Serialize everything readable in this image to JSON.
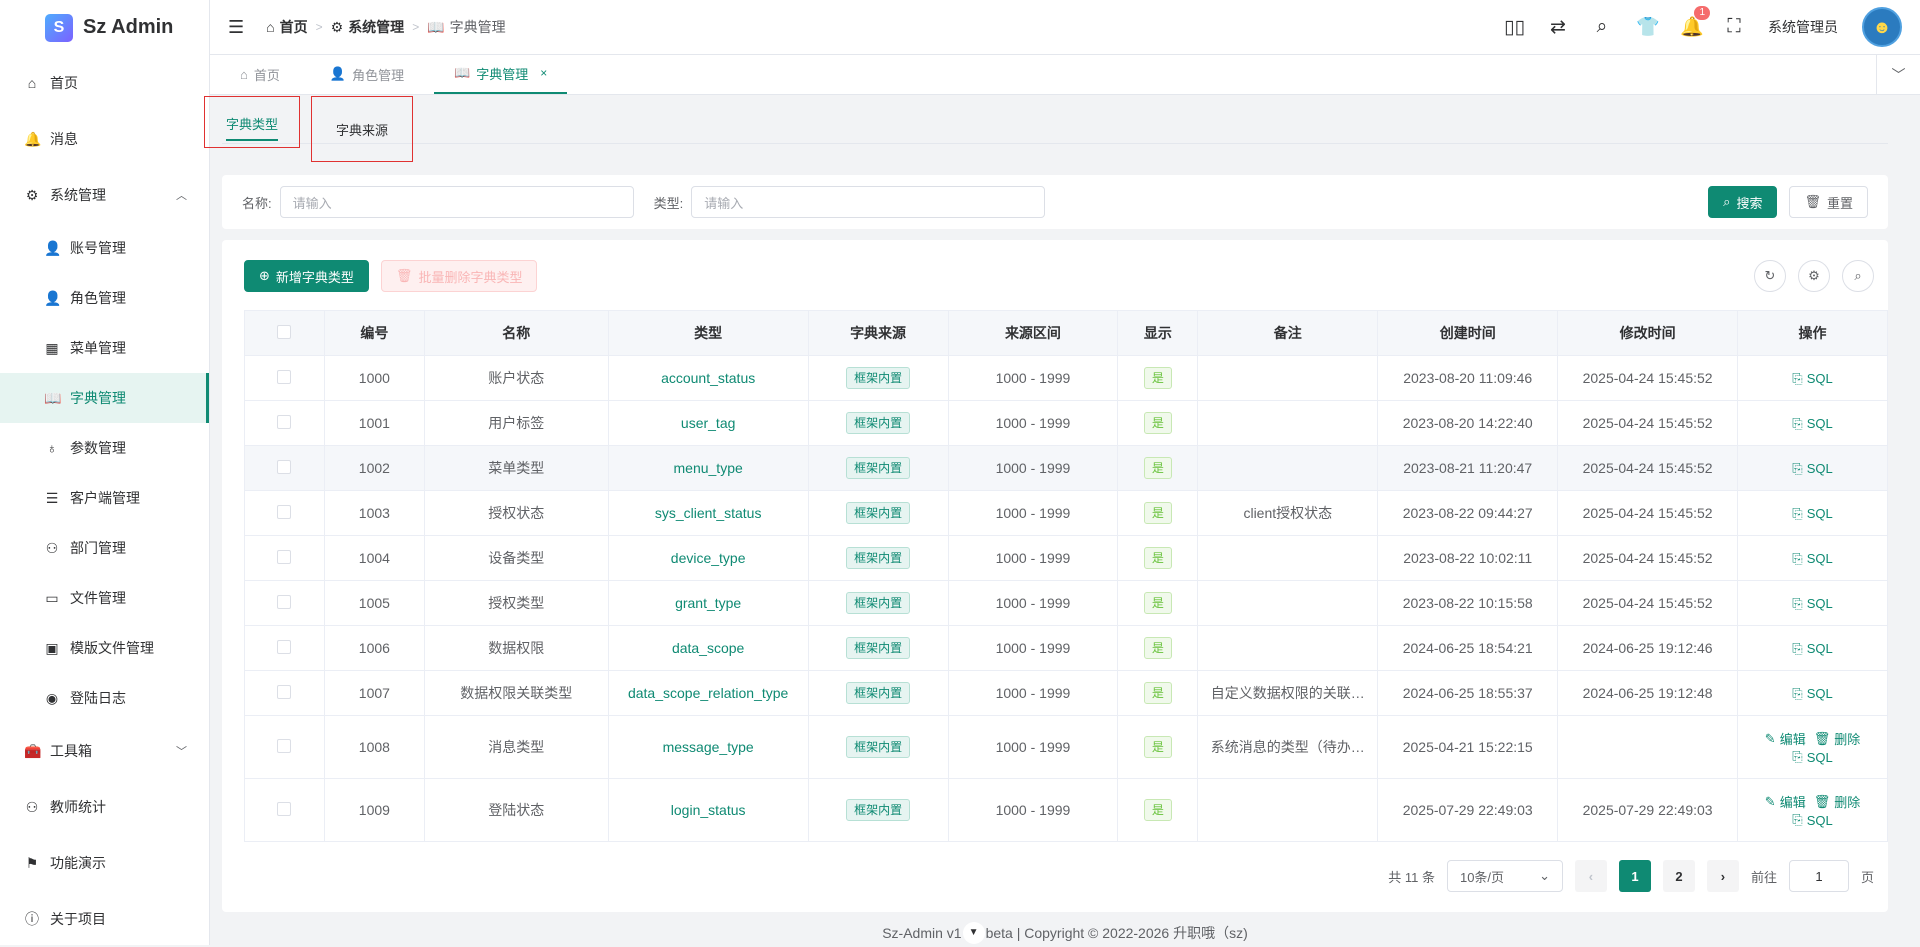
{
  "app": {
    "logo_text": "Sz Admin",
    "logo_mark": "S"
  },
  "sidebar": {
    "items": [
      {
        "label": "首页",
        "icon": "home-icon",
        "glyph": "⌂"
      },
      {
        "label": "消息",
        "icon": "bell-icon",
        "glyph": "🔔"
      },
      {
        "label": "系统管理",
        "icon": "gear-icon",
        "glyph": "⚙",
        "arrow": "︿"
      },
      {
        "label": "账号管理",
        "icon": "user-icon",
        "glyph": "👤"
      },
      {
        "label": "角色管理",
        "icon": "user-outline-icon",
        "glyph": "👤"
      },
      {
        "label": "菜单管理",
        "icon": "grid-icon",
        "glyph": "▦"
      },
      {
        "label": "字典管理",
        "icon": "book-icon",
        "glyph": "📖"
      },
      {
        "label": "参数管理",
        "icon": "param-icon",
        "glyph": "♁"
      },
      {
        "label": "客户端管理",
        "icon": "sliders-icon",
        "glyph": "☰"
      },
      {
        "label": "部门管理",
        "icon": "org-icon",
        "glyph": "⚇"
      },
      {
        "label": "文件管理",
        "icon": "folder-icon",
        "glyph": "▭"
      },
      {
        "label": "模版文件管理",
        "icon": "template-icon",
        "glyph": "▣"
      },
      {
        "label": "登陆日志",
        "icon": "location-icon",
        "glyph": "◉"
      },
      {
        "label": "工具箱",
        "icon": "toolbox-icon",
        "glyph": "🧰",
        "arrow": "﹀"
      },
      {
        "label": "教师统计",
        "icon": "org-chart-icon",
        "glyph": "⚇"
      },
      {
        "label": "功能演示",
        "icon": "flag-icon",
        "glyph": "⚑"
      },
      {
        "label": "关于项目",
        "icon": "info-icon",
        "glyph": "ⓘ"
      }
    ]
  },
  "header": {
    "breadcrumb": [
      {
        "label": "首页",
        "glyph": "⌂"
      },
      {
        "label": "系统管理",
        "glyph": "⚙"
      },
      {
        "label": "字典管理",
        "glyph": "📖"
      }
    ],
    "breadcrumb_sep": ">",
    "notification_count": "1",
    "username": "系统管理员",
    "avatar_glyph": "☻"
  },
  "tabs": [
    {
      "label": "首页",
      "glyph": "⌂"
    },
    {
      "label": "角色管理",
      "glyph": "👤"
    },
    {
      "label": "字典管理",
      "glyph": "📖",
      "close": "×"
    }
  ],
  "tabs_more": "﹀",
  "subtabs": [
    "字典类型",
    "字典来源"
  ],
  "search": {
    "name_label": "名称:",
    "name_placeholder": "请输入",
    "type_label": "类型:",
    "type_placeholder": "请输入",
    "search_btn": "搜索",
    "reset_btn": "重置"
  },
  "toolbar": {
    "add_btn": "新增字典类型",
    "batch_delete_btn": "批量删除字典类型"
  },
  "table": {
    "headers": [
      "编号",
      "名称",
      "类型",
      "字典来源",
      "来源区间",
      "显示",
      "备注",
      "创建时间",
      "修改时间",
      "操作"
    ],
    "rows": [
      {
        "id": "1000",
        "name": "账户状态",
        "type": "account_status",
        "source": "框架内置",
        "range": "1000 - 1999",
        "show": "是",
        "note": "",
        "created": "2023-08-20 11:09:46",
        "updated": "2025-04-24 15:45:52",
        "editable": false
      },
      {
        "id": "1001",
        "name": "用户标签",
        "type": "user_tag",
        "source": "框架内置",
        "range": "1000 - 1999",
        "show": "是",
        "note": "",
        "created": "2023-08-20 14:22:40",
        "updated": "2025-04-24 15:45:52",
        "editable": false
      },
      {
        "id": "1002",
        "name": "菜单类型",
        "type": "menu_type",
        "source": "框架内置",
        "range": "1000 - 1999",
        "show": "是",
        "note": "",
        "created": "2023-08-21 11:20:47",
        "updated": "2025-04-24 15:45:52",
        "editable": false
      },
      {
        "id": "1003",
        "name": "授权状态",
        "type": "sys_client_status",
        "source": "框架内置",
        "range": "1000 - 1999",
        "show": "是",
        "note": "client授权状态",
        "created": "2023-08-22 09:44:27",
        "updated": "2025-04-24 15:45:52",
        "editable": false
      },
      {
        "id": "1004",
        "name": "设备类型",
        "type": "device_type",
        "source": "框架内置",
        "range": "1000 - 1999",
        "show": "是",
        "note": "",
        "created": "2023-08-22 10:02:11",
        "updated": "2025-04-24 15:45:52",
        "editable": false
      },
      {
        "id": "1005",
        "name": "授权类型",
        "type": "grant_type",
        "source": "框架内置",
        "range": "1000 - 1999",
        "show": "是",
        "note": "",
        "created": "2023-08-22 10:15:58",
        "updated": "2025-04-24 15:45:52",
        "editable": false
      },
      {
        "id": "1006",
        "name": "数据权限",
        "type": "data_scope",
        "source": "框架内置",
        "range": "1000 - 1999",
        "show": "是",
        "note": "",
        "created": "2024-06-25 18:54:21",
        "updated": "2024-06-25 19:12:46",
        "editable": false
      },
      {
        "id": "1007",
        "name": "数据权限关联类型",
        "type": "data_scope_relation_type",
        "source": "框架内置",
        "range": "1000 - 1999",
        "show": "是",
        "note": "自定义数据权限的关联…",
        "created": "2024-06-25 18:55:37",
        "updated": "2024-06-25 19:12:48",
        "editable": false
      },
      {
        "id": "1008",
        "name": "消息类型",
        "type": "message_type",
        "source": "框架内置",
        "range": "1000 - 1999",
        "show": "是",
        "note": "系统消息的类型（待办…",
        "created": "2025-04-21 15:22:15",
        "updated": "",
        "editable": true
      },
      {
        "id": "1009",
        "name": "登陆状态",
        "type": "login_status",
        "source": "框架内置",
        "range": "1000 - 1999",
        "show": "是",
        "note": "",
        "created": "2025-07-29 22:49:03",
        "updated": "2025-07-29 22:49:03",
        "editable": true
      }
    ],
    "action_sql": "SQL",
    "action_edit": "编辑",
    "action_delete": "删除"
  },
  "pagination": {
    "total": "共 11 条",
    "page_size": "10条/页",
    "pages": [
      "1",
      "2"
    ],
    "current": "1",
    "goto_label": "前往",
    "goto_value": "1",
    "page_unit": "页",
    "prev": "‹",
    "next": "›"
  },
  "footer": {
    "text_left": "Sz-Admin v1",
    "text_right": "beta | Copyright © 2022-2026 升职哦（sz)",
    "toggle": "▼"
  }
}
